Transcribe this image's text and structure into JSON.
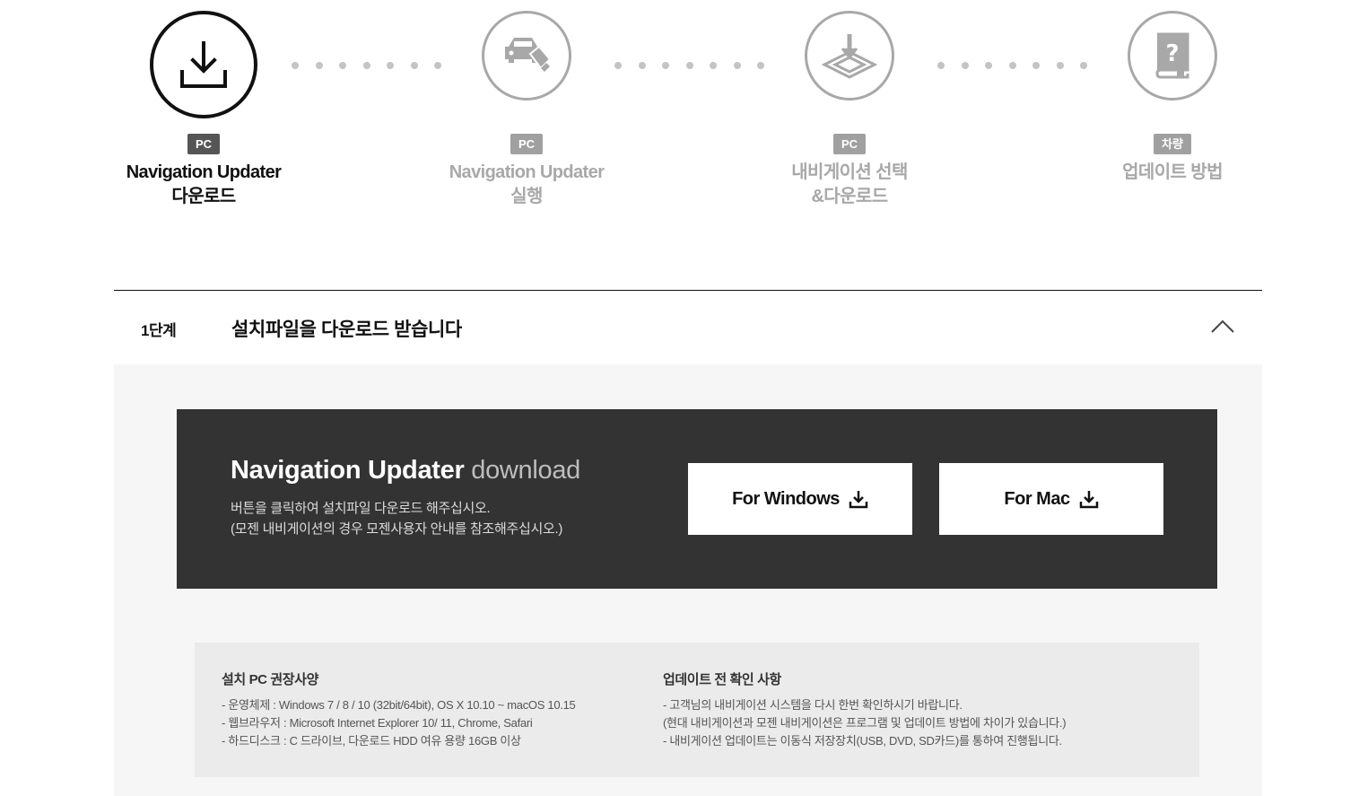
{
  "steps": [
    {
      "badge": "PC",
      "title_line1": "Navigation Updater",
      "title_line2": "다운로드",
      "icon": "download-icon",
      "active": true
    },
    {
      "badge": "PC",
      "title_line1": "Navigation Updater",
      "title_line2": "실행",
      "icon": "car-usb-icon",
      "active": false
    },
    {
      "badge": "PC",
      "title_line1": "내비게이션 선택",
      "title_line2": "&다운로드",
      "icon": "install-map-icon",
      "active": false
    },
    {
      "badge": "차량",
      "title_line1": "업데이트 방법",
      "title_line2": "",
      "icon": "help-book-icon",
      "active": false
    }
  ],
  "accordion": {
    "step_no": "1단계",
    "title": "설치파일을 다운로드 받습니다",
    "toggle_icon": "chevron-up-icon"
  },
  "download": {
    "heading_bold": "Navigation Updater",
    "heading_light": "download",
    "desc_line1": "버튼을 클릭하여 설치파일 다운로드 해주십시오.",
    "desc_line2": "(모젠 내비게이션의 경우 모젠사용자 안내를 참조해주십시오.)",
    "windows_label": "For Windows",
    "mac_label": "For Mac"
  },
  "requirements": {
    "title": "설치 PC 권장사양",
    "lines": [
      "- 운영체제 : Windows 7 / 8 / 10 (32bit/64bit), OS X 10.10 ~ macOS 10.15",
      "- 웹브라우저 : Microsoft Internet Explorer 10/ 11, Chrome, Safari",
      "- 하드디스크 : C 드라이브, 다운로드 HDD 여유 용량 16GB 이상"
    ]
  },
  "precheck": {
    "title": "업데이트 전 확인 사항",
    "lines": [
      "- 고객님의 내비게이션 시스템을 다시 한번 확인하시기 바랍니다.",
      " (현대 내비게이션과 모젠 내비게이션은 프로그램 및 업데이트 방법에 차이가 있습니다.)",
      "- 내비게이션 업데이트는 이동식 저장장치(USB, DVD, SD카드)를 통하여 진행됩니다."
    ]
  },
  "colors": {
    "accent_dark": "#333333",
    "inactive_gray": "#a8a8a8",
    "panel_bg": "#f6f6f6"
  }
}
